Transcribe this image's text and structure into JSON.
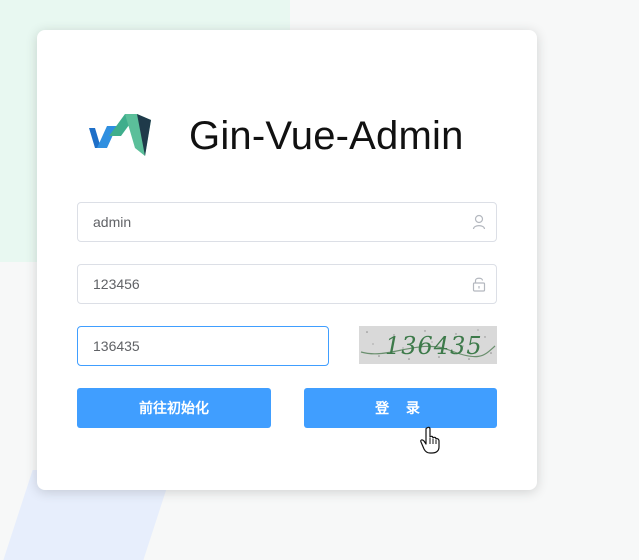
{
  "app": {
    "title": "Gin-Vue-Admin"
  },
  "form": {
    "username": {
      "value": "admin"
    },
    "password": {
      "value": "123456"
    },
    "captcha_input": {
      "value": "136435"
    },
    "captcha_image_text": "136435"
  },
  "buttons": {
    "init_label": "前往初始化",
    "login_label": "登 录"
  },
  "icons": {
    "username_suffix": "user-icon",
    "password_suffix": "unlock-icon",
    "logo": "gin-vue-admin-logo",
    "cursor": "hand-pointer-icon"
  },
  "colors": {
    "primary": "#409eff",
    "input_border": "#dcdfe6",
    "logo_blue": "#1e6fc8",
    "logo_green": "#3fae8c",
    "logo_dark": "#1f3a4a",
    "captcha_bg": "#d8d8d8",
    "captcha_text": "#3d7a4a"
  }
}
